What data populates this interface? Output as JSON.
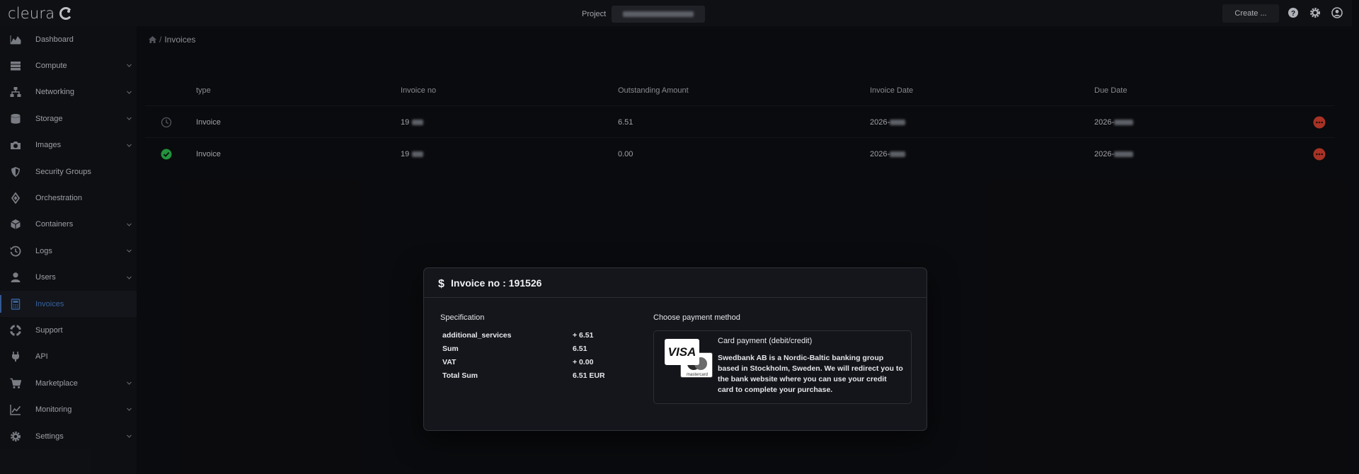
{
  "topbar": {
    "logo_text": "cleura",
    "project_label": "Project",
    "create_label": "Create ..."
  },
  "sidebar": {
    "items": [
      {
        "label": "Dashboard",
        "icon": "chart-area-icon",
        "expandable": false
      },
      {
        "label": "Compute",
        "icon": "server-icon",
        "expandable": true
      },
      {
        "label": "Networking",
        "icon": "network-icon",
        "expandable": true
      },
      {
        "label": "Storage",
        "icon": "database-icon",
        "expandable": true
      },
      {
        "label": "Images",
        "icon": "camera-icon",
        "expandable": true
      },
      {
        "label": "Security Groups",
        "icon": "shield-icon",
        "expandable": false
      },
      {
        "label": "Orchestration",
        "icon": "diamond-icon",
        "expandable": false
      },
      {
        "label": "Containers",
        "icon": "cube-icon",
        "expandable": true
      },
      {
        "label": "Logs",
        "icon": "history-icon",
        "expandable": true
      },
      {
        "label": "Users",
        "icon": "user-icon",
        "expandable": true
      },
      {
        "label": "Invoices",
        "icon": "calculator-icon",
        "expandable": false,
        "active": true
      },
      {
        "label": "Support",
        "icon": "lifebuoy-icon",
        "expandable": false
      },
      {
        "label": "API",
        "icon": "plug-icon",
        "expandable": false
      },
      {
        "label": "Marketplace",
        "icon": "cart-icon",
        "expandable": true
      },
      {
        "label": "Monitoring",
        "icon": "line-chart-icon",
        "expandable": true
      },
      {
        "label": "Settings",
        "icon": "gear-icon",
        "expandable": true
      }
    ]
  },
  "breadcrumb": {
    "current": "Invoices"
  },
  "table": {
    "columns": [
      "type",
      "Invoice no",
      "Outstanding Amount",
      "Invoice Date",
      "Due Date"
    ],
    "rows": [
      {
        "status_icon": "clock-icon",
        "type": "Invoice",
        "invoice_no": "19",
        "amount": "6.51",
        "invoice_date": "2026-",
        "due_date": "2026-"
      },
      {
        "status_icon": "check-circle-icon",
        "type": "Invoice",
        "invoice_no": "19",
        "amount": "0.00",
        "invoice_date": "2026-",
        "due_date": "2026-"
      }
    ]
  },
  "modal": {
    "title": "Invoice no : 191526",
    "spec_title": "Specification",
    "spec_rows": [
      {
        "key": "additional_services",
        "value": "+ 6.51"
      },
      {
        "key": "Sum",
        "value": "6.51"
      },
      {
        "key": "VAT",
        "value": "+ 0.00"
      },
      {
        "key": "Total Sum",
        "value": "6.51 EUR"
      }
    ],
    "payment_title": "Choose payment method",
    "card_title": "Card payment (debit/credit)",
    "card_desc": "Swedbank AB is a Nordic-Baltic banking group based in Stockholm, Sweden. We will redirect you to the bank website where you can use your credit card to complete your purchase.",
    "visa_text": "VISA",
    "mastercard_text": "mastercard"
  },
  "colors": {
    "accent": "#3c63a8",
    "success": "#27a745",
    "danger": "#c0392b",
    "background": "#0c0d10"
  }
}
